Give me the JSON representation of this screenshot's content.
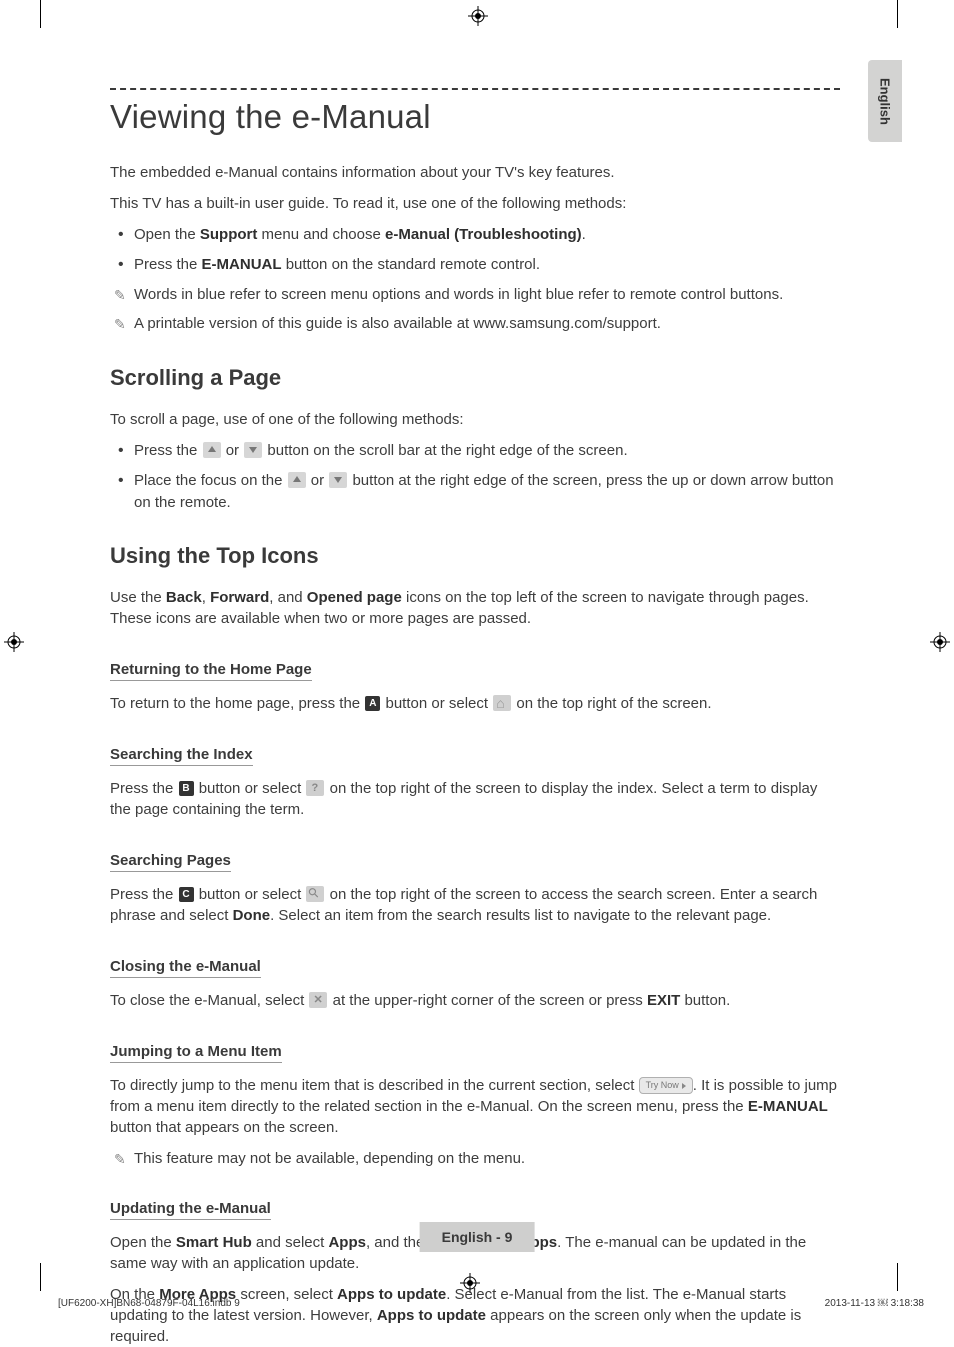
{
  "sideTab": "English",
  "title": "Viewing the e-Manual",
  "intro1": "The embedded e-Manual contains information about your TV's key features.",
  "intro2": "This TV has a built-in user guide. To read it, use one of the following methods:",
  "introList": {
    "i1a": "Open the ",
    "i1b": "Support",
    "i1c": " menu and choose ",
    "i1d": "e-Manual (Troubleshooting)",
    "i1e": ".",
    "i2a": "Press the ",
    "i2b": "E-MANUAL",
    "i2c": " button on the standard remote control.",
    "i3": "Words in blue refer to screen menu options and words in light blue refer to remote control buttons.",
    "i4": "A printable version of this guide is also available at www.samsung.com/support."
  },
  "scroll": {
    "h": "Scrolling a Page",
    "p": "To scroll a page, use of one of the following methods:",
    "l1a": "Press the ",
    "l1b": " or ",
    "l1c": " button on the scroll bar at the right edge of the screen.",
    "l2a": "Place the focus on the ",
    "l2b": " or ",
    "l2c": " button at the right edge of the screen, press the up or down arrow button on the remote."
  },
  "icons": {
    "h": "Using the Top Icons",
    "p1a": "Use the ",
    "p1b": "Back",
    "p1c": ", ",
    "p1d": "Forward",
    "p1e": ", and ",
    "p1f": "Opened page",
    "p1g": " icons on the top left of the screen to navigate through pages. These icons are available when two or more pages are passed."
  },
  "returnHome": {
    "h": "Returning to the Home Page",
    "p1a": "To return to the home page, press the ",
    "p1b": " button or select ",
    "p1c": " on the top right of the screen.",
    "letterA": "A"
  },
  "searchIndex": {
    "h": "Searching the Index",
    "p1a": "Press the ",
    "p1b": " button or select ",
    "p1c": " on the top right of the screen to display the index. Select a term to display the page containing the term.",
    "letterB": "B"
  },
  "searchPages": {
    "h": "Searching Pages",
    "p1a": "Press the ",
    "p1b": " button or select ",
    "p1c": " on the top right of the screen to access the search screen. Enter a search phrase and select ",
    "p1d": "Done",
    "p1e": ". Select an item from the search results list to navigate to the relevant page.",
    "letterC": "C"
  },
  "closing": {
    "h": "Closing the e-Manual",
    "p1a": "To close the e-Manual, select ",
    "p1b": " at the upper-right corner of the screen or press ",
    "p1c": "EXIT",
    "p1d": " button."
  },
  "jumping": {
    "h": "Jumping to a Menu Item",
    "tryNow": "Try Now",
    "p1a": "To directly jump to the menu item that is described in the current section, select ",
    "p1b": ". It is possible to jump from a menu item directly to the related section in the e-Manual. On the screen menu, press the ",
    "p1c": "E-MANUAL",
    "p1d": " button that appears on the screen.",
    "note": "This feature may not be available, depending on the menu."
  },
  "updating": {
    "h": "Updating the e-Manual",
    "p1a": "Open the ",
    "p1b": "Smart Hub",
    "p1c": " and select ",
    "p1d": "Apps",
    "p1e": ", and then select ",
    "p1f": "More Apps",
    "p1g": ". The e-manual can be updated in the same way with an application update.",
    "p2a": "On the ",
    "p2b": "More Apps",
    "p2c": " screen, select ",
    "p2d": "Apps to update",
    "p2e": ". Select e-Manual from the list. The e-Manual starts updating to the latest version. However, ",
    "p2f": "Apps to update",
    "p2g": " appears on the screen only when the update is required."
  },
  "footer": "English - 9",
  "printLeft": "[UF6200-XH]BN68-04879F-04L16.indb   9",
  "printRight": "2013-11-13   ￼ 3:18:38"
}
